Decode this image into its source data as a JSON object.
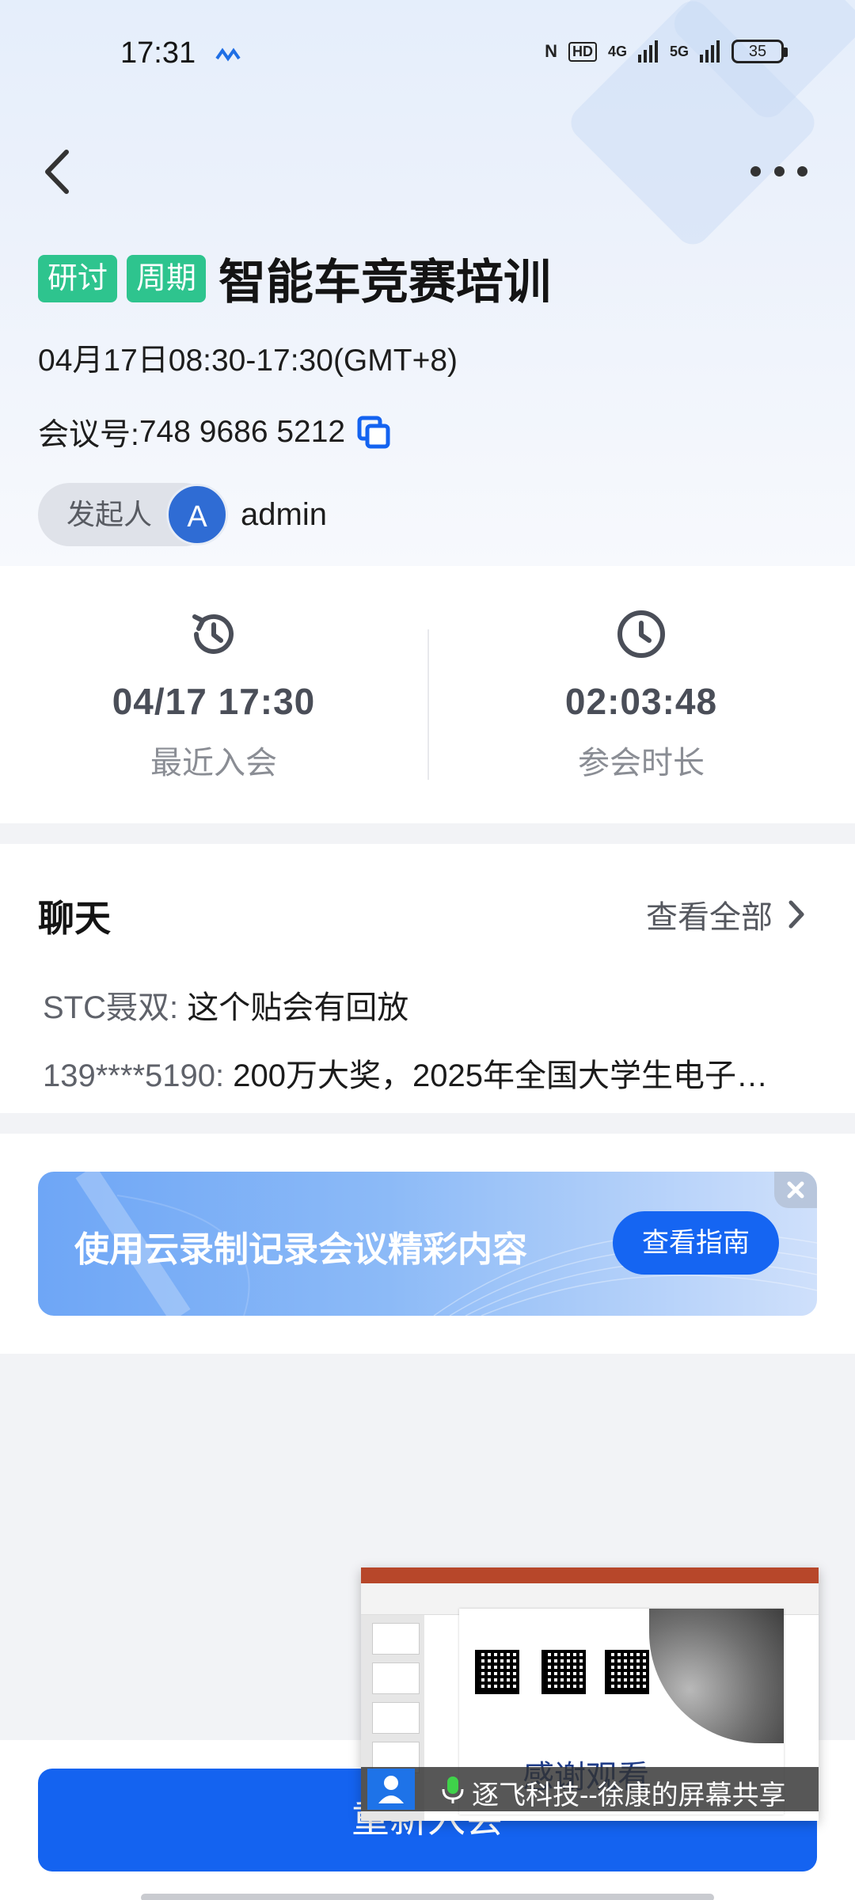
{
  "status_bar": {
    "time": "17:31",
    "nfc": "N",
    "hd": "HD",
    "signal_1": "4G",
    "signal_2": "5G",
    "battery": "35"
  },
  "header": {
    "back_icon": "chevron-left-icon",
    "more_icon": "more-dots-icon"
  },
  "meeting": {
    "tags": [
      "研讨",
      "周期"
    ],
    "title": "智能车竞赛培训",
    "time_range": "04月17日08:30-17:30(GMT+8)",
    "id_label": "会议号: ",
    "id_value": "748 9686 5212",
    "host_label": "发起人",
    "host_avatar_letter": "A",
    "host_name": "admin"
  },
  "stats": [
    {
      "icon": "history-clock-icon",
      "value": "04/17 17:30",
      "label": "最近入会"
    },
    {
      "icon": "clock-icon",
      "value": "02:03:48",
      "label": "参会时长"
    }
  ],
  "chat": {
    "title": "聊天",
    "view_all": "查看全部",
    "messages": [
      {
        "sender": "STC聂双: ",
        "text": "这个贴会有回放"
      },
      {
        "sender": "139****5190: ",
        "text": "200万大奖，2025年全国大学生电子…"
      }
    ]
  },
  "promo": {
    "text": "使用云录制记录会议精彩内容",
    "button": "查看指南"
  },
  "bottom": {
    "join_button": "重新入会"
  },
  "floating_window": {
    "slide_text": "感谢观看",
    "share_text": "逐飞科技--徐康的屏幕共享"
  },
  "colors": {
    "accent": "#1463f0",
    "tag_green": "#2ec48e"
  }
}
